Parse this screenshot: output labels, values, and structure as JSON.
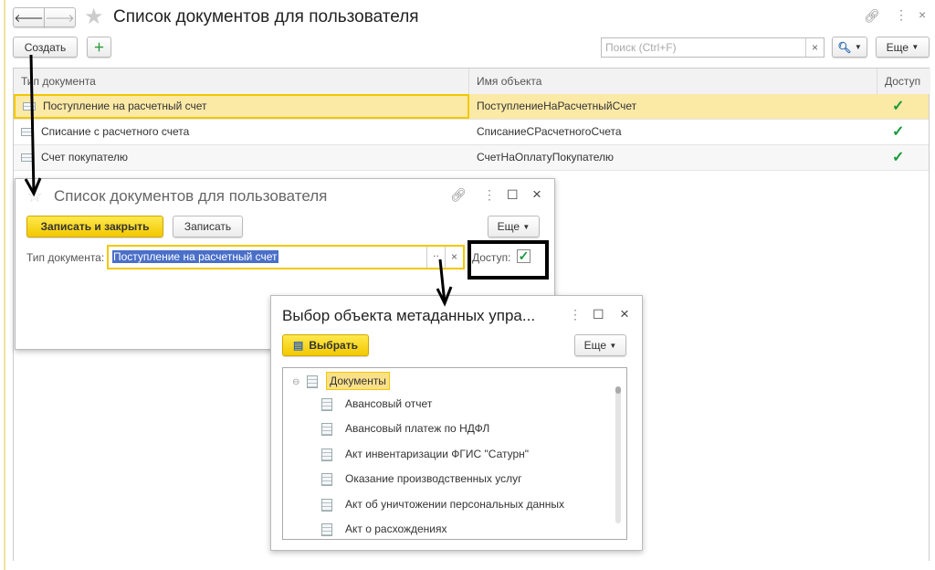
{
  "main": {
    "title": "Список документов для пользователя",
    "create_label": "Создать",
    "search_placeholder": "Поиск (Ctrl+F)",
    "more_label": "Еще",
    "columns": [
      "Тип документа",
      "Имя объекта",
      "Доступ"
    ],
    "rows": [
      {
        "type": "Поступление на расчетный счет",
        "name": "ПоступлениеНаРасчетныйСчет",
        "access": "✓"
      },
      {
        "type": "Списание с расчетного счета",
        "name": "СписаниеСРасчетногоСчета",
        "access": "✓"
      },
      {
        "type": "Счет покупателю",
        "name": "СчетНаОплатуПокупателю",
        "access": "✓"
      }
    ]
  },
  "edit_dialog": {
    "title": "Список документов для пользователя",
    "save_close_label": "Записать и закрыть",
    "save_label": "Записать",
    "more_label": "Еще",
    "doc_type_label": "Тип документа:",
    "doc_type_value": "Поступление на расчетный счет",
    "access_label": "Доступ:",
    "access_checked": true
  },
  "select_dialog": {
    "title": "Выбор объекта метаданных упра...",
    "select_label": "Выбрать",
    "more_label": "Еще",
    "root": "Документы",
    "items": [
      "Авансовый отчет",
      "Авансовый платеж по НДФЛ",
      "Акт инвентаризации ФГИС \"Сатурн\"",
      "Оказание производственных услуг",
      "Акт об уничтожении персональных данных",
      "Акт о расхождениях"
    ]
  },
  "colors": {
    "accent": "#f2c800",
    "selection": "#fbe9a6",
    "check": "#1a9a3a"
  }
}
